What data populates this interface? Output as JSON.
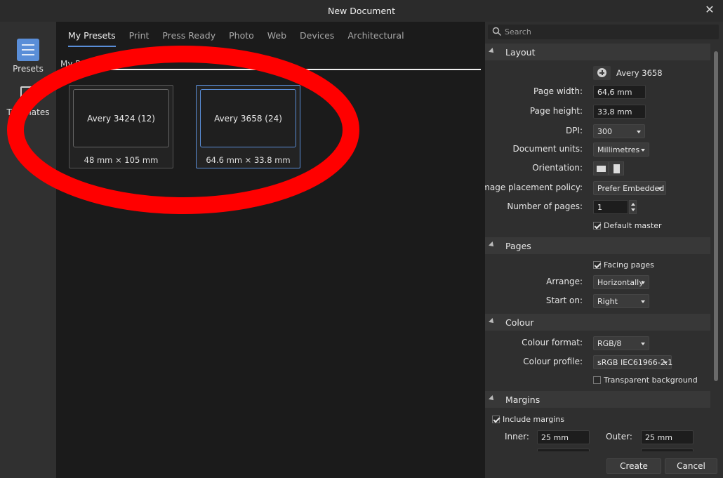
{
  "window": {
    "title": "New Document",
    "close_glyph": "✕"
  },
  "leftbar": {
    "items": [
      {
        "label": "Presets",
        "icon": "presets-icon",
        "active": true
      },
      {
        "label": "Templates",
        "icon": "templates-icon",
        "active": false
      }
    ],
    "accent": "#5a8ed8"
  },
  "tabs": [
    {
      "label": "My Presets",
      "active": true
    },
    {
      "label": "Print"
    },
    {
      "label": "Press Ready"
    },
    {
      "label": "Photo"
    },
    {
      "label": "Web"
    },
    {
      "label": "Devices"
    },
    {
      "label": "Architectural"
    }
  ],
  "presets_section": {
    "label": "My Presets"
  },
  "presets": [
    {
      "name": "Avery 3424 (12)",
      "dims": "48 mm × 105 mm",
      "selected": false
    },
    {
      "name": "Avery 3658 (24)",
      "dims": "64.6 mm × 33.8 mm",
      "selected": true
    }
  ],
  "annotation": {
    "color": "#ff0000",
    "shape": "ellipse"
  },
  "search": {
    "placeholder": "Search"
  },
  "layout": {
    "header": "Layout",
    "preset_name": "Avery 3658",
    "page_width_label": "Page width:",
    "page_width": "64,6 mm",
    "page_height_label": "Page height:",
    "page_height": "33,8 mm",
    "dpi_label": "DPI:",
    "dpi": "300",
    "units_label": "Document units:",
    "units": "Millimetres",
    "orientation_label": "Orientation:",
    "placement_label": "Image placement policy:",
    "placement": "Prefer Embedded",
    "pages_label": "Number of pages:",
    "pages": "1",
    "default_master": "Default master"
  },
  "pages": {
    "header": "Pages",
    "facing": "Facing pages",
    "arrange_label": "Arrange:",
    "arrange": "Horizontally",
    "start_label": "Start on:",
    "start": "Right"
  },
  "colour": {
    "header": "Colour",
    "format_label": "Colour format:",
    "format": "RGB/8",
    "profile_label": "Colour profile:",
    "profile": "sRGB IEC61966-2.1",
    "transparent": "Transparent background"
  },
  "margins": {
    "header": "Margins",
    "include": "Include margins",
    "inner_label": "Inner:",
    "inner": "25 mm",
    "outer_label": "Outer:",
    "outer": "25 mm"
  },
  "footer": {
    "create": "Create",
    "cancel": "Cancel"
  }
}
